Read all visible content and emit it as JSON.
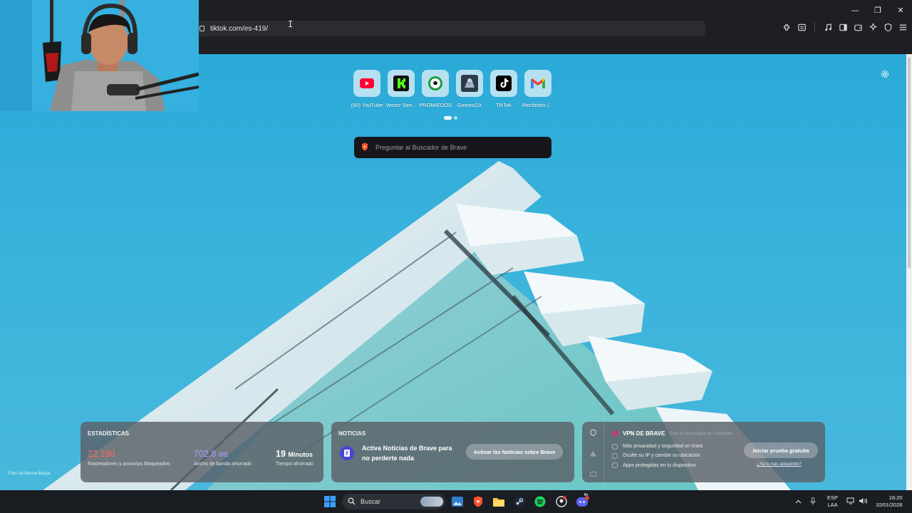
{
  "browser": {
    "url": "tiktok.com/es-419/",
    "window_controls": {
      "minimize": "—",
      "restore": "❐",
      "close": "✕"
    }
  },
  "new_tab": {
    "top_sites": [
      {
        "label": "(60) YouTube",
        "icon": "youtube-icon"
      },
      {
        "label": "Vector Stre...",
        "icon": "kick-icon"
      },
      {
        "label": "PROMIEDOS",
        "icon": "soccer-ball-icon"
      },
      {
        "label": "GamesGX",
        "icon": "gamesgx-icon"
      },
      {
        "label": "TikTok",
        "icon": "tiktok-icon"
      },
      {
        "label": "Recibidos (...",
        "icon": "gmail-icon"
      }
    ],
    "search_placeholder": "Preguntar al Buscador de Brave",
    "photo_credit": "Foto de Bema Banja"
  },
  "widgets": {
    "stats": {
      "heading": "ESTADÍSTICAS",
      "trackers_value": "22,190",
      "trackers_label": "Rastreadores y anuncios bloqueados",
      "bandwidth_value": "702.8",
      "bandwidth_unit": "MB",
      "bandwidth_label": "Ancho de banda ahorrado",
      "time_value": "19",
      "time_unit": "Minutos",
      "time_label": "Tiempo ahorrado"
    },
    "news": {
      "heading": "NOTICIAS",
      "text": "Activa Noticias de Brave para no perderte nada",
      "button": "Activar las Noticias sobre Brave"
    },
    "vpn": {
      "title": "VPN DE BRAVE",
      "tech": "Con la tecnología de Guardian",
      "features": [
        "Más privacidad y seguridad en línea",
        "Oculte su IP y cambie su ubicación",
        "Apps protegidas en tu dispositivo"
      ],
      "button": "Iniciar prueba gratuita",
      "link": "¿Ya lo has adquirido?"
    }
  },
  "taskbar": {
    "search": "Buscar",
    "lang_top": "ESP",
    "lang_bottom": "LAA",
    "time": "16:20",
    "date": "10/01/2026",
    "discord_badge": "9+"
  },
  "colors": {
    "sky": "#2aa9d8",
    "trackers": "#ff6a5e",
    "bandwidth": "#a99bff",
    "brave": "#fb542b"
  }
}
